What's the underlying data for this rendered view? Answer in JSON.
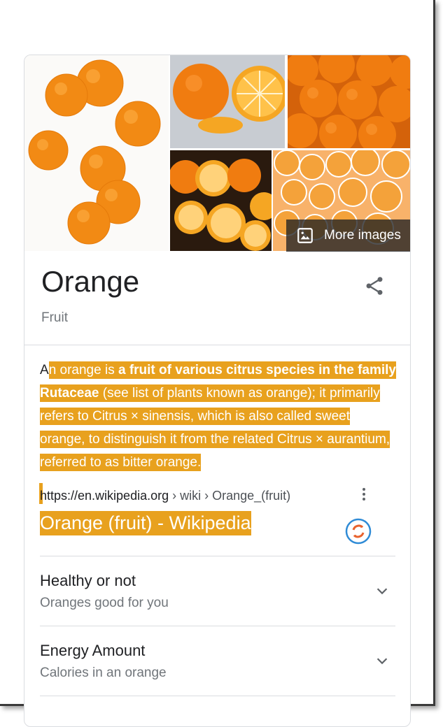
{
  "gallery": {
    "more_images_label": "More images"
  },
  "entity": {
    "title": "Orange",
    "subtitle": "Fruit"
  },
  "description": {
    "lead": "A",
    "part1": "n orange is ",
    "bold": "a fruit of various citrus species in the family Rutaceae",
    "part2": " (see list of plants known as orange); it primarily refers to Citrus × sinensis, which is also called sweet orange, to distinguish it from the related Citrus × aurantium, referred to as bitter orange."
  },
  "source": {
    "domain": "https://en.wikipedia.org",
    "crumbs": " › wiki › Orange_(fruit)",
    "link_title": "Orange (fruit) - Wikipedia"
  },
  "accordions": [
    {
      "heading": "Healthy or not",
      "sub": "Oranges good for you"
    },
    {
      "heading": "Energy Amount",
      "sub": "Calories in an orange"
    }
  ],
  "colors": {
    "highlight": "#e8a11e",
    "orange_fruit": "#f28a14",
    "divider": "#dadce0",
    "secondary_text": "#70757a"
  },
  "icons": [
    "image-icon",
    "share-icon",
    "more-vert-icon",
    "refresh-icon",
    "chevron-down-icon"
  ]
}
